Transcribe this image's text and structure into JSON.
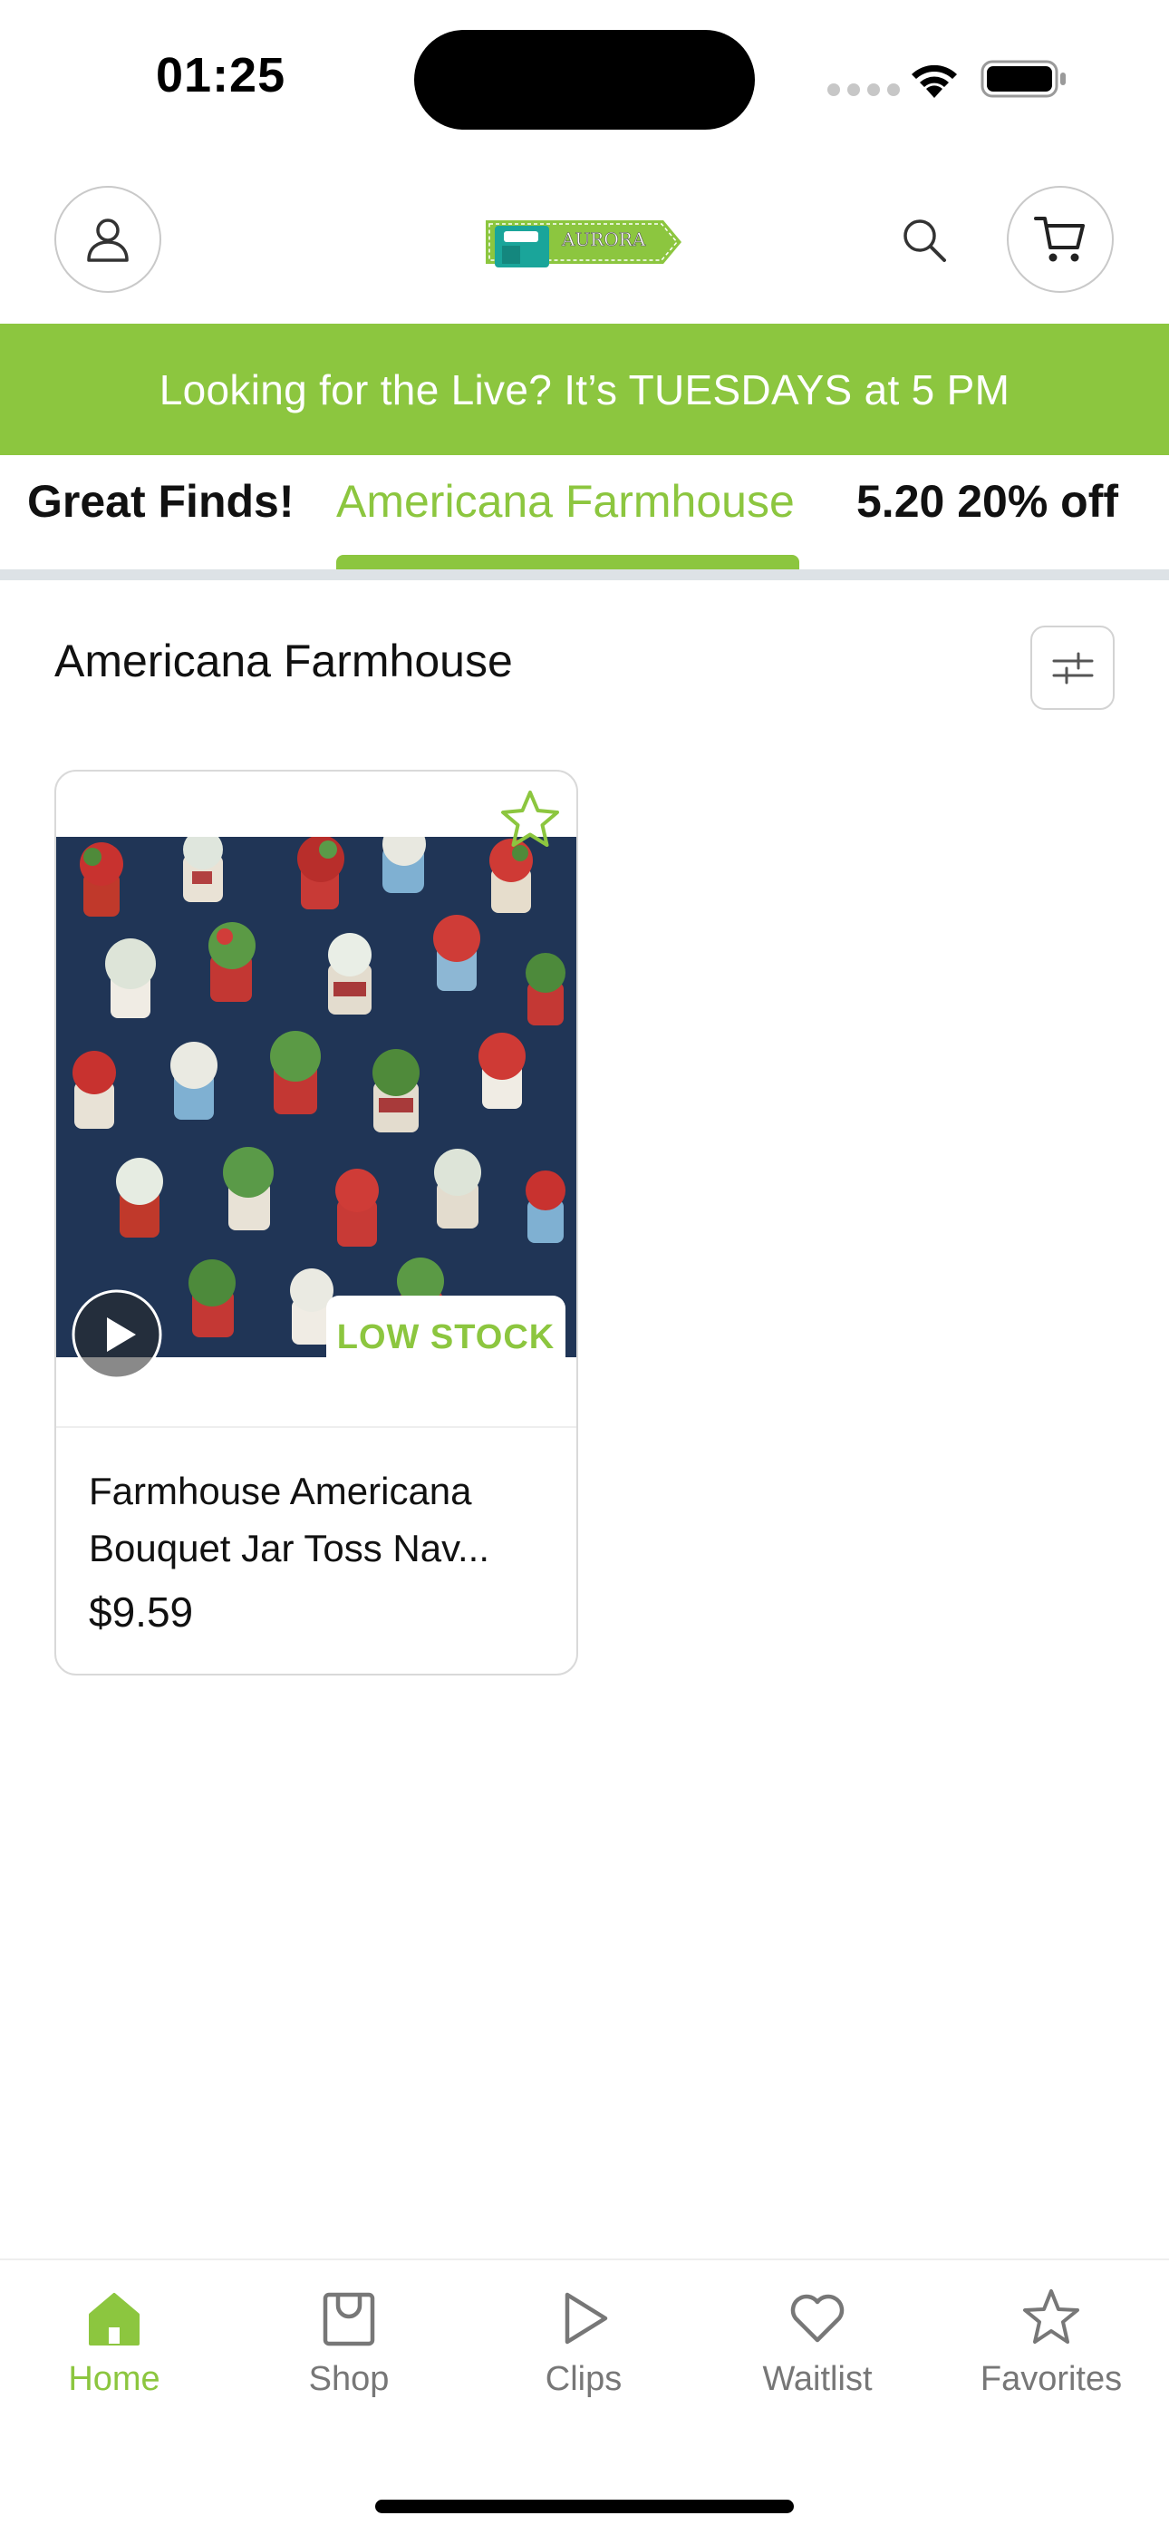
{
  "status_bar": {
    "time": "01:25"
  },
  "header": {
    "logo_text": "AURORA",
    "profile_icon": "user-icon",
    "search_icon": "search-icon",
    "cart_icon": "cart-icon"
  },
  "banner": {
    "text": "Looking for the Live?  It’s TUESDAYS at 5 PM"
  },
  "tabs": [
    {
      "label": "Great Finds!",
      "active": false
    },
    {
      "label": "Americana Farmhouse",
      "active": true
    },
    {
      "label": "5.20 20% off",
      "active": false
    }
  ],
  "section": {
    "title": "Americana Farmhouse",
    "filter_icon": "sliders-icon"
  },
  "products": [
    {
      "name": "Farmhouse Americana Bouquet Jar Toss Nav...",
      "price": "$9.59",
      "badge": "LOW STOCK",
      "favorite_icon": "star-outline-icon",
      "video_icon": "play-icon"
    }
  ],
  "bottom_nav": [
    {
      "label": "Home",
      "icon": "home-icon",
      "active": true
    },
    {
      "label": "Shop",
      "icon": "shopping-bag-icon",
      "active": false
    },
    {
      "label": "Clips",
      "icon": "play-triangle-icon",
      "active": false
    },
    {
      "label": "Waitlist",
      "icon": "heart-icon",
      "active": false
    },
    {
      "label": "Favorites",
      "icon": "star-icon",
      "active": false
    }
  ],
  "colors": {
    "accent": "#8cc63f",
    "banner_bg": "#8cc63f",
    "fabric_bg": "#1f3457"
  }
}
